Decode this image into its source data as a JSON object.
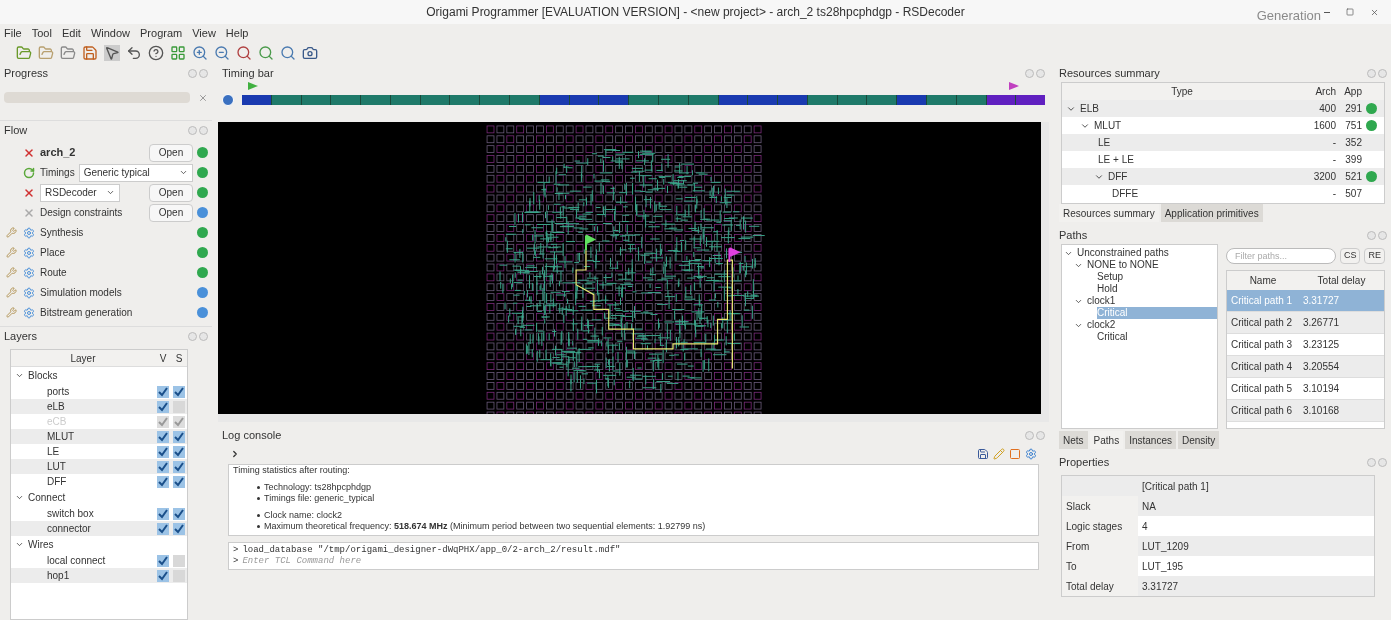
{
  "window": {
    "title": "Origami Programmer  [EVALUATION VERSION] - <new project> - arch_2 ts28hpcphdgp - RSDecoder",
    "logo_text": "Generation"
  },
  "menu": [
    "File",
    "Tool",
    "Edit",
    "Window",
    "Program",
    "View",
    "Help"
  ],
  "progress": {
    "title": "Progress",
    "level": 0
  },
  "flow": {
    "title": "Flow",
    "items": [
      {
        "kind": "project",
        "label": "arch_2",
        "button": "Open",
        "color": "#2fa84f"
      },
      {
        "kind": "select",
        "label": "Timings",
        "value": "Generic typical",
        "color": "#2fa84f"
      },
      {
        "kind": "dropdown",
        "value": "RSDecoder",
        "button": "Open",
        "color": "#2fa84f"
      },
      {
        "kind": "file",
        "label": "Design constraints",
        "button": "Open",
        "color": "#4a90d9"
      },
      {
        "kind": "step",
        "label": "Synthesis",
        "color": "#2fa84f"
      },
      {
        "kind": "step",
        "label": "Place",
        "color": "#2fa84f"
      },
      {
        "kind": "step",
        "label": "Route",
        "color": "#2fa84f"
      },
      {
        "kind": "step",
        "label": "Simulation models",
        "color": "#4a90d9"
      },
      {
        "kind": "step",
        "label": "Bitstream generation",
        "color": "#4a90d9"
      }
    ]
  },
  "layers": {
    "title": "Layers",
    "columns": [
      "Layer",
      "V",
      "S"
    ],
    "groups": [
      {
        "label": "Blocks",
        "expanded": true,
        "children": [
          {
            "label": "ports",
            "disabled": false,
            "v": true,
            "s": true
          },
          {
            "label": "eLB",
            "disabled": false,
            "v": true,
            "s": false
          },
          {
            "label": "eCB",
            "disabled": true,
            "v": true,
            "s": true
          },
          {
            "label": "MLUT",
            "disabled": false,
            "v": true,
            "s": true
          },
          {
            "label": "LE",
            "disabled": false,
            "v": true,
            "s": true
          },
          {
            "label": "LUT",
            "disabled": false,
            "v": true,
            "s": true
          },
          {
            "label": "DFF",
            "disabled": false,
            "v": true,
            "s": true
          }
        ]
      },
      {
        "label": "Connect",
        "expanded": true,
        "children": [
          {
            "label": "switch box",
            "disabled": false,
            "v": true,
            "s": true
          },
          {
            "label": "connector",
            "disabled": false,
            "v": true,
            "s": true
          }
        ]
      },
      {
        "label": "Wires",
        "expanded": true,
        "children": [
          {
            "label": "local connect",
            "disabled": false,
            "v": true,
            "s": false
          },
          {
            "label": "hop1",
            "disabled": false,
            "v": true,
            "s": false
          }
        ]
      }
    ]
  },
  "timing_bar": {
    "title": "Timing bar"
  },
  "log": {
    "title": "Log console",
    "heading": "Timing statistics after routing:",
    "bullet_groups": [
      [
        "Technology: ts28hpcphdgp",
        "Timings file: generic_typical"
      ],
      [
        "Clock name: clock2",
        "Maximum theoretical frequency: **518.674 MHz** (Minimum period between two sequential elements: 1.92799 ns)"
      ]
    ],
    "prompt": ">",
    "history": [
      "load_database \"/tmp/origami_designer-dWqPHX/app_0/2-arch_2/result.mdf\""
    ],
    "placeholder": "Enter TCL Command here"
  },
  "resources": {
    "title": "Resources summary",
    "columns": [
      "Type",
      "Arch",
      "App"
    ],
    "rows": [
      {
        "type": "ELB",
        "arch": "400",
        "app": "291",
        "ok": true,
        "expanded": true,
        "children": [
          {
            "type": "MLUT",
            "arch": "1600",
            "app": "751",
            "ok": true,
            "expanded": true,
            "children": [
              {
                "type": "LE",
                "arch": "-",
                "app": "352",
                "ok": false
              },
              {
                "type": "LE + LE",
                "arch": "-",
                "app": "399",
                "ok": false
              },
              {
                "type": "DFF",
                "arch": "3200",
                "app": "521",
                "ok": true,
                "expanded": true,
                "children": [
                  {
                    "type": "DFFE",
                    "arch": "-",
                    "app": "507",
                    "ok": false
                  }
                ]
              }
            ]
          }
        ]
      }
    ],
    "tabs": [
      {
        "label": "Resources summary",
        "selected": true
      },
      {
        "label": "Application primitives",
        "selected": false
      }
    ]
  },
  "paths": {
    "title": "Paths",
    "tree": [
      {
        "label": "Unconstrained paths",
        "selected": false,
        "children": [
          {
            "label": "NONE to NONE",
            "selected": false,
            "children": [
              {
                "label": "Setup",
                "selected": false
              },
              {
                "label": "Hold",
                "selected": false
              }
            ]
          },
          {
            "label": "clock1",
            "selected": false,
            "children": [
              {
                "label": "Critical",
                "selected": true
              }
            ]
          },
          {
            "label": "clock2",
            "selected": false,
            "children": [
              {
                "label": "Critical",
                "selected": false
              }
            ]
          }
        ]
      }
    ],
    "filter_placeholder": "Filter paths...",
    "filter_buttons": [
      "CS",
      "RE"
    ],
    "columns": [
      "Name",
      "Total delay"
    ],
    "rows": [
      {
        "name": "Critical path 1",
        "delay": "3.31727",
        "selected": true
      },
      {
        "name": "Critical path 2",
        "delay": "3.26771",
        "selected": false
      },
      {
        "name": "Critical path 3",
        "delay": "3.23125",
        "selected": false
      },
      {
        "name": "Critical path 4",
        "delay": "3.20554",
        "selected": false
      },
      {
        "name": "Critical path 5",
        "delay": "3.10194",
        "selected": false
      },
      {
        "name": "Critical path 6",
        "delay": "3.10168",
        "selected": false
      }
    ],
    "tabs": [
      {
        "label": "Nets",
        "selected": false
      },
      {
        "label": "Paths",
        "selected": true
      },
      {
        "label": "Instances",
        "selected": false
      },
      {
        "label": "Density",
        "selected": false
      }
    ]
  },
  "properties": {
    "title": "Properties",
    "header": "[Critical path 1]",
    "rows": [
      {
        "key": "Slack",
        "value": "NA"
      },
      {
        "key": "Logic stages",
        "value": "4"
      },
      {
        "key": "From",
        "value": "LUT_1209"
      },
      {
        "key": "To",
        "value": "LUT_195"
      },
      {
        "key": "Total delay",
        "value": "3.31727"
      }
    ]
  }
}
